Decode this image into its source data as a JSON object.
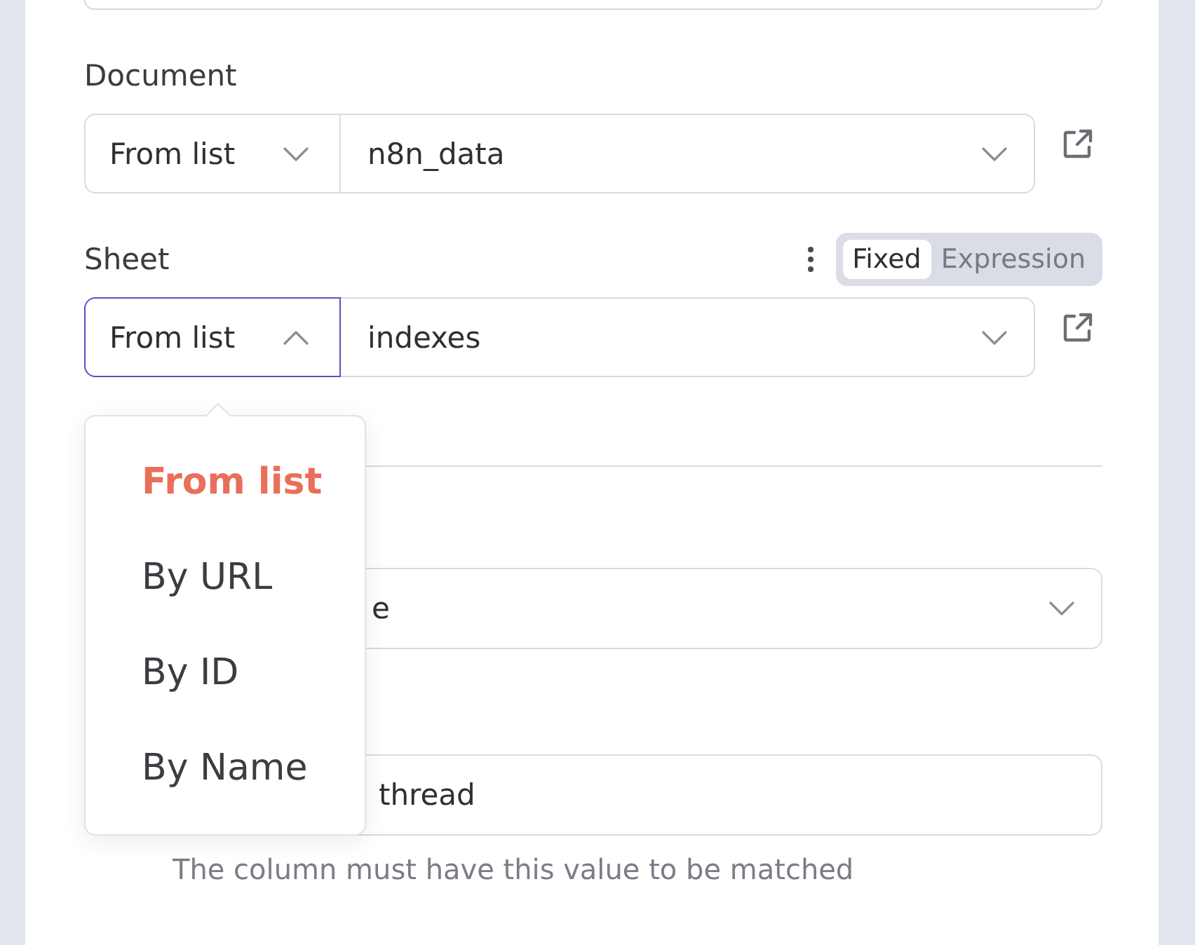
{
  "parameters": [
    {
      "kind": "field_edge"
    },
    {
      "kind": "locator",
      "label": "Document",
      "mode": "From list",
      "mode_open": false,
      "value": "n8n_data"
    },
    {
      "kind": "locator",
      "label": "Sheet",
      "mode": "From list",
      "mode_open": true,
      "value": "indexes",
      "toggle": [
        {
          "label": "Fixed",
          "selected": true
        },
        {
          "label": "Expression",
          "selected": false
        }
      ],
      "menu": {
        "items": [
          {
            "label": "From list",
            "selected": true
          },
          {
            "label": "By URL",
            "selected": false
          },
          {
            "label": "By ID",
            "selected": false
          },
          {
            "label": "By Name",
            "selected": false
          }
        ]
      }
    },
    {
      "kind": "divider"
    },
    {
      "kind": "select",
      "value": "e"
    },
    {
      "kind": "input",
      "value": "thread",
      "hint": "The column must have this value to be matched"
    }
  ]
}
